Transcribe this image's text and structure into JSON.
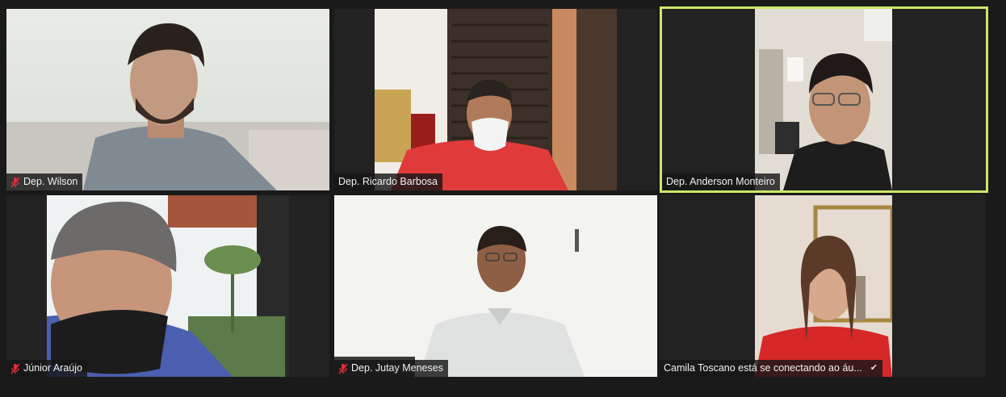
{
  "participants": [
    {
      "name": "Dep. Wilson",
      "muted": true
    },
    {
      "name": "Dep. Ricardo Barbosa",
      "muted": false
    },
    {
      "name": "Dep. Anderson Monteiro",
      "muted": false
    },
    {
      "name": "Júnior Araújo",
      "muted": true
    },
    {
      "name": "Dep. Jutay Meneses",
      "muted": true
    },
    {
      "name": "Camila Toscano está se conectando ao áu...",
      "muted": false
    }
  ],
  "colors": {
    "active_speaker_border": "#cbe86a",
    "muted_icon": "#e0303a",
    "tile_bg": "#222222"
  },
  "icons": [
    "muted-mic-icon",
    "checkmark-icon"
  ]
}
